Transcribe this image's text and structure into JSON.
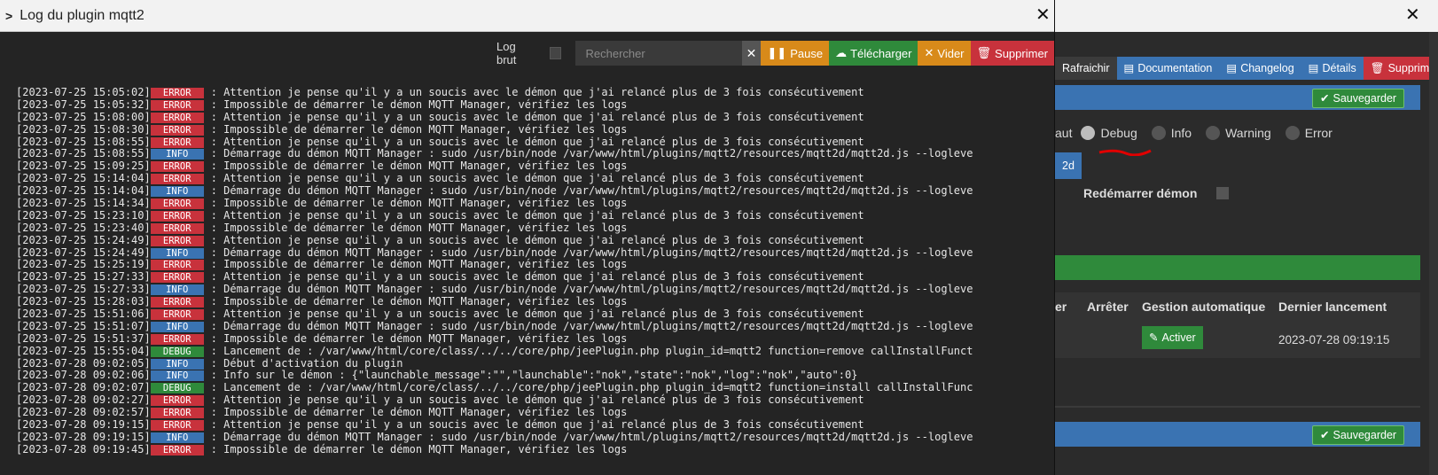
{
  "modal": {
    "title": "Log du plugin mqtt2",
    "toolbar": {
      "logbrut_label": "Log brut",
      "search_placeholder": "Rechercher",
      "pause": "Pause",
      "download": "Télécharger",
      "empty": "Vider",
      "delete": "Supprimer"
    },
    "log_lines": [
      {
        "ts": "[2023-07-25 15:05:02]",
        "level": "ERROR",
        "msg": ": Attention je pense qu'il y a un soucis avec le démon que j'ai relancé plus de 3 fois consécutivement"
      },
      {
        "ts": "[2023-07-25 15:05:32]",
        "level": "ERROR",
        "msg": ": Impossible de démarrer le démon MQTT Manager, vérifiez les logs"
      },
      {
        "ts": "[2023-07-25 15:08:00]",
        "level": "ERROR",
        "msg": ": Attention je pense qu'il y a un soucis avec le démon que j'ai relancé plus de 3 fois consécutivement"
      },
      {
        "ts": "[2023-07-25 15:08:30]",
        "level": "ERROR",
        "msg": ": Impossible de démarrer le démon MQTT Manager, vérifiez les logs"
      },
      {
        "ts": "[2023-07-25 15:08:55]",
        "level": "ERROR",
        "msg": ": Attention je pense qu'il y a un soucis avec le démon que j'ai relancé plus de 3 fois consécutivement"
      },
      {
        "ts": "[2023-07-25 15:08:55]",
        "level": "INFO",
        "msg": ": Démarrage du démon MQTT Manager : sudo  /usr/bin/node /var/www/html/plugins/mqtt2/resources/mqtt2d/mqtt2d.js --logleve"
      },
      {
        "ts": "[2023-07-25 15:09:25]",
        "level": "ERROR",
        "msg": ": Impossible de démarrer le démon MQTT Manager, vérifiez les logs"
      },
      {
        "ts": "[2023-07-25 15:14:04]",
        "level": "ERROR",
        "msg": ": Attention je pense qu'il y a un soucis avec le démon que j'ai relancé plus de 3 fois consécutivement"
      },
      {
        "ts": "[2023-07-25 15:14:04]",
        "level": "INFO",
        "msg": ": Démarrage du démon MQTT Manager : sudo  /usr/bin/node /var/www/html/plugins/mqtt2/resources/mqtt2d/mqtt2d.js --logleve"
      },
      {
        "ts": "[2023-07-25 15:14:34]",
        "level": "ERROR",
        "msg": ": Impossible de démarrer le démon MQTT Manager, vérifiez les logs"
      },
      {
        "ts": "[2023-07-25 15:23:10]",
        "level": "ERROR",
        "msg": ": Attention je pense qu'il y a un soucis avec le démon que j'ai relancé plus de 3 fois consécutivement"
      },
      {
        "ts": "[2023-07-25 15:23:40]",
        "level": "ERROR",
        "msg": ": Impossible de démarrer le démon MQTT Manager, vérifiez les logs"
      },
      {
        "ts": "[2023-07-25 15:24:49]",
        "level": "ERROR",
        "msg": ": Attention je pense qu'il y a un soucis avec le démon que j'ai relancé plus de 3 fois consécutivement"
      },
      {
        "ts": "[2023-07-25 15:24:49]",
        "level": "INFO",
        "msg": ": Démarrage du démon MQTT Manager : sudo  /usr/bin/node /var/www/html/plugins/mqtt2/resources/mqtt2d/mqtt2d.js --logleve"
      },
      {
        "ts": "[2023-07-25 15:25:19]",
        "level": "ERROR",
        "msg": ": Impossible de démarrer le démon MQTT Manager, vérifiez les logs"
      },
      {
        "ts": "[2023-07-25 15:27:33]",
        "level": "ERROR",
        "msg": ": Attention je pense qu'il y a un soucis avec le démon que j'ai relancé plus de 3 fois consécutivement"
      },
      {
        "ts": "[2023-07-25 15:27:33]",
        "level": "INFO",
        "msg": ": Démarrage du démon MQTT Manager : sudo  /usr/bin/node /var/www/html/plugins/mqtt2/resources/mqtt2d/mqtt2d.js --logleve"
      },
      {
        "ts": "[2023-07-25 15:28:03]",
        "level": "ERROR",
        "msg": ": Impossible de démarrer le démon MQTT Manager, vérifiez les logs"
      },
      {
        "ts": "[2023-07-25 15:51:06]",
        "level": "ERROR",
        "msg": ": Attention je pense qu'il y a un soucis avec le démon que j'ai relancé plus de 3 fois consécutivement"
      },
      {
        "ts": "[2023-07-25 15:51:07]",
        "level": "INFO",
        "msg": ": Démarrage du démon MQTT Manager : sudo  /usr/bin/node /var/www/html/plugins/mqtt2/resources/mqtt2d/mqtt2d.js --logleve"
      },
      {
        "ts": "[2023-07-25 15:51:37]",
        "level": "ERROR",
        "msg": ": Impossible de démarrer le démon MQTT Manager, vérifiez les logs"
      },
      {
        "ts": "[2023-07-25 15:55:04]",
        "level": "DEBUG",
        "msg": ": Lancement de : /var/www/html/core/class/../../core/php/jeePlugin.php  plugin_id=mqtt2 function=remove callInstallFunct"
      },
      {
        "ts": "[2023-07-28 09:02:05]",
        "level": "INFO",
        "msg": ": Début d'activation du plugin"
      },
      {
        "ts": "[2023-07-28 09:02:06]",
        "level": "INFO",
        "msg": ": Info sur le démon : {\"launchable_message\":\"\",\"launchable\":\"nok\",\"state\":\"nok\",\"log\":\"nok\",\"auto\":0}"
      },
      {
        "ts": "[2023-07-28 09:02:07]",
        "level": "DEBUG",
        "msg": ": Lancement de : /var/www/html/core/class/../../core/php/jeePlugin.php  plugin_id=mqtt2 function=install callInstallFunc"
      },
      {
        "ts": "[2023-07-28 09:02:27]",
        "level": "ERROR",
        "msg": ": Attention je pense qu'il y a un soucis avec le démon que j'ai relancé plus de 3 fois consécutivement"
      },
      {
        "ts": "[2023-07-28 09:02:57]",
        "level": "ERROR",
        "msg": ": Impossible de démarrer le démon MQTT Manager, vérifiez les logs"
      },
      {
        "ts": "[2023-07-28 09:19:15]",
        "level": "ERROR",
        "msg": ": Attention je pense qu'il y a un soucis avec le démon que j'ai relancé plus de 3 fois consécutivement"
      },
      {
        "ts": "[2023-07-28 09:19:15]",
        "level": "INFO",
        "msg": ": Démarrage du démon MQTT Manager : sudo  /usr/bin/node /var/www/html/plugins/mqtt2/resources/mqtt2d/mqtt2d.js --logleve"
      },
      {
        "ts": "[2023-07-28 09:19:45]",
        "level": "ERROR",
        "msg": ": Impossible de démarrer le démon MQTT Manager, vérifiez les logs"
      }
    ]
  },
  "background": {
    "buttons": {
      "refresh": "Rafraichir",
      "documentation": "Documentation",
      "changelog": "Changelog",
      "details": "Détails",
      "delete": "Supprimer"
    },
    "save_label": "Sauvegarder",
    "log_levels": {
      "default_partial": "aut",
      "debug": "Debug",
      "info": "Info",
      "warning": "Warning",
      "error": "Error"
    },
    "partial_button": "2d",
    "restart_daemon_label": "Redémarrer démon",
    "table": {
      "col_partial": "er",
      "col_stop": "Arrêter",
      "col_auto": "Gestion automatique",
      "col_last": "Dernier lancement",
      "activate_button": "Activer",
      "last_launch": "2023-07-28 09:19:15"
    }
  },
  "colors": {
    "error": "#c8323c",
    "info": "#3a73b2",
    "debug": "#2f8a3b",
    "pause": "#d88a1a",
    "download": "#2f8a3b",
    "annotation": "#e00000"
  }
}
